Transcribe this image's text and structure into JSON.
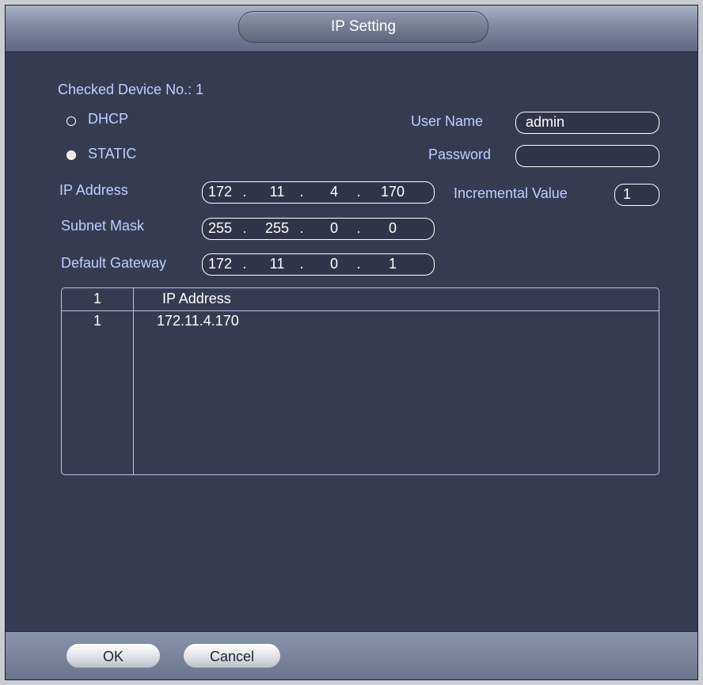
{
  "dialog": {
    "title": "IP Setting",
    "checked_device": "Checked Device No.: 1",
    "mode": {
      "options": [
        {
          "label": "DHCP",
          "selected": false
        },
        {
          "label": "STATIC",
          "selected": true
        }
      ]
    },
    "user_name": {
      "label": "User Name",
      "value": "admin"
    },
    "password": {
      "label": "Password",
      "value": ""
    },
    "ip_address": {
      "label": "IP Address",
      "octets": [
        "172",
        "11",
        "4",
        "170"
      ]
    },
    "incremental": {
      "label": "Incremental Value",
      "value": "1"
    },
    "subnet_mask": {
      "label": "Subnet Mask",
      "octets": [
        "255",
        "255",
        "0",
        "0"
      ]
    },
    "gateway": {
      "label": "Default Gateway",
      "octets": [
        "172",
        "11",
        "0",
        "1"
      ]
    },
    "ip_separator": ".",
    "table": {
      "headers": [
        "1",
        "IP Address"
      ],
      "rows": [
        {
          "no": "1",
          "ip": "172.11.4.170"
        }
      ]
    },
    "buttons": {
      "ok": "OK",
      "cancel": "Cancel"
    }
  }
}
